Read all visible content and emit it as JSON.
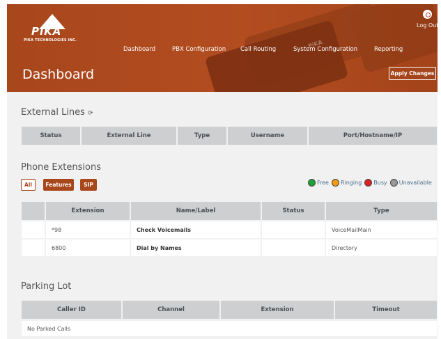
{
  "header": {
    "logo_text": "PiKA",
    "logo_subtext": "PIKA TECHNOLOGIES INC.",
    "page_title": "Dashboard",
    "apply_changes_label": "Apply Changes",
    "logout_label": "Log Out",
    "nav": [
      {
        "label": "Dashboard"
      },
      {
        "label": "PBX Configuration"
      },
      {
        "label": "Call Routing"
      },
      {
        "label": "System Configuration"
      },
      {
        "label": "Reporting"
      }
    ]
  },
  "external_lines": {
    "title": "External Lines",
    "columns": [
      "Status",
      "External Line",
      "Type",
      "Username",
      "Port/Hostname/IP"
    ]
  },
  "phone_extensions": {
    "title": "Phone Extensions",
    "filters": [
      "All",
      "Features",
      "SIP"
    ],
    "legend": [
      {
        "label": "Free",
        "color": "#1aa336"
      },
      {
        "label": "Ringing",
        "color": "#f39c12"
      },
      {
        "label": "Busy",
        "color": "#dd2222"
      },
      {
        "label": "Unavailable",
        "color": "#9a9a9a"
      }
    ],
    "columns": [
      "",
      "Extension",
      "Name/Label",
      "Status",
      "Type"
    ],
    "rows": [
      {
        "extension": "*98",
        "name": "Check Voicemails",
        "status": "",
        "type": "VoiceMailMain"
      },
      {
        "extension": "6800",
        "name": "Dial by Names",
        "status": "",
        "type": "Directory"
      }
    ]
  },
  "parking_lot": {
    "title": "Parking Lot",
    "columns": [
      "Caller ID",
      "Channel",
      "Extension",
      "Timeout"
    ],
    "empty_text": "No Parked Calls"
  },
  "colors": {
    "brand": "#a8461c",
    "header_cell": "#cdcfd1",
    "content_bg": "#f1f1f1"
  }
}
